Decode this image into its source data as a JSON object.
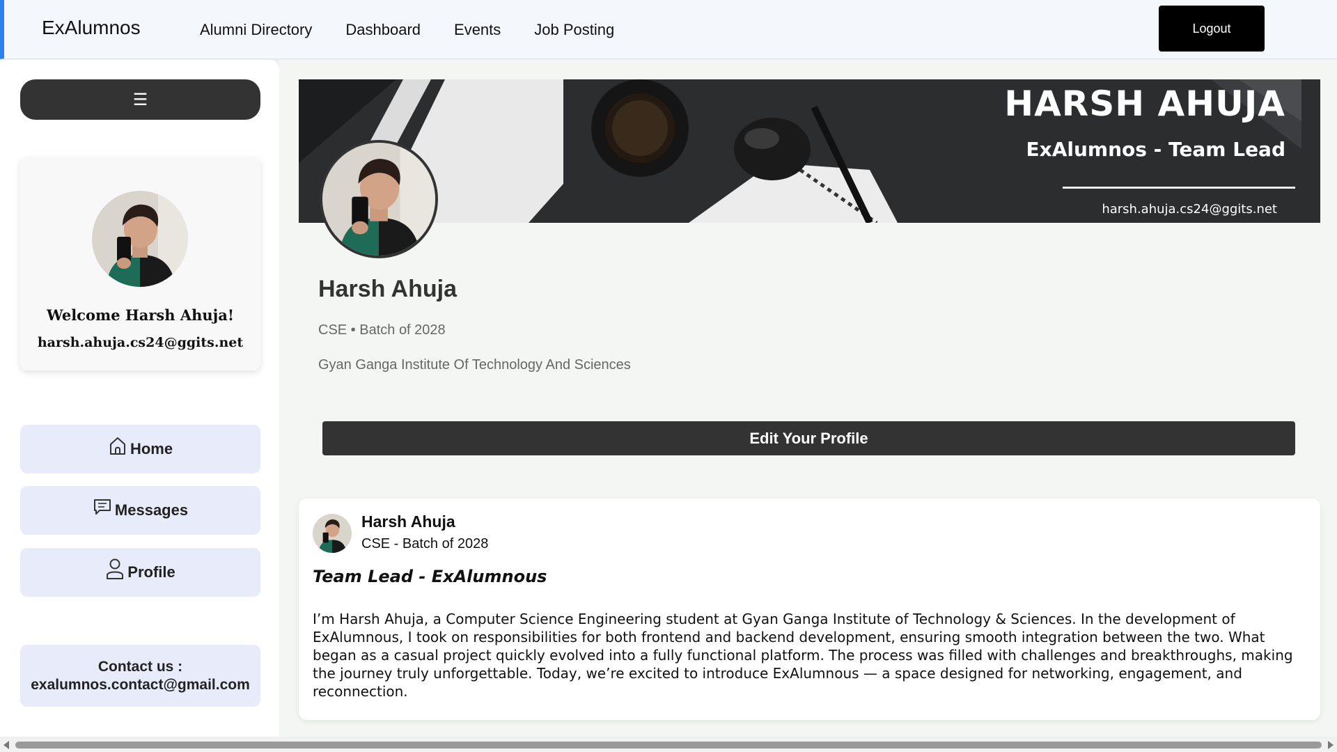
{
  "nav": {
    "brand": "ExAlumnos",
    "links": [
      "Alumni Directory",
      "Dashboard",
      "Events",
      "Job Posting"
    ],
    "logout_label": "Logout"
  },
  "sidebar": {
    "menu_icon": "☰",
    "welcome_title": "Welcome Harsh Ahuja!",
    "welcome_email": "harsh.ahuja.cs24@ggits.net",
    "items": [
      {
        "label": "Home",
        "icon": "home-icon"
      },
      {
        "label": "Messages",
        "icon": "message-icon"
      },
      {
        "label": "Profile",
        "icon": "user-icon"
      }
    ],
    "contact_label": "Contact us :",
    "contact_email": "exalumnos.contact@gmail.com"
  },
  "profile": {
    "banner_name": "HARSH AHUJA",
    "banner_role": "ExAlumnos - Team Lead",
    "banner_email": "harsh.ahuja.cs24@ggits.net",
    "name": "Harsh Ahuja",
    "batch": "CSE • Batch of 2028",
    "school": "Gyan Ganga Institute Of Technology And Sciences",
    "edit_label": "Edit Your Profile"
  },
  "post": {
    "author": "Harsh Ahuja",
    "batch": "CSE - Batch of 2028",
    "title": "Team Lead - ExAlumnous",
    "body": "I’m Harsh Ahuja, a Computer Science Engineering student at Gyan Ganga Institute of Technology & Sciences. In the development of ExAlumnous, I took on responsibilities for both frontend and backend development, ensuring smooth integration between the two. What began as a casual project quickly evolved into a fully functional platform. The process was filled with challenges and breakthroughs, making the journey truly unforgettable. Today, we’re excited to introduce ExAlumnous — a space designed for networking, engagement, and reconnection."
  },
  "colors": {
    "accent": "#2f80ed",
    "dark_button": "#333333",
    "side_button_bg": "#e8ecfa"
  }
}
